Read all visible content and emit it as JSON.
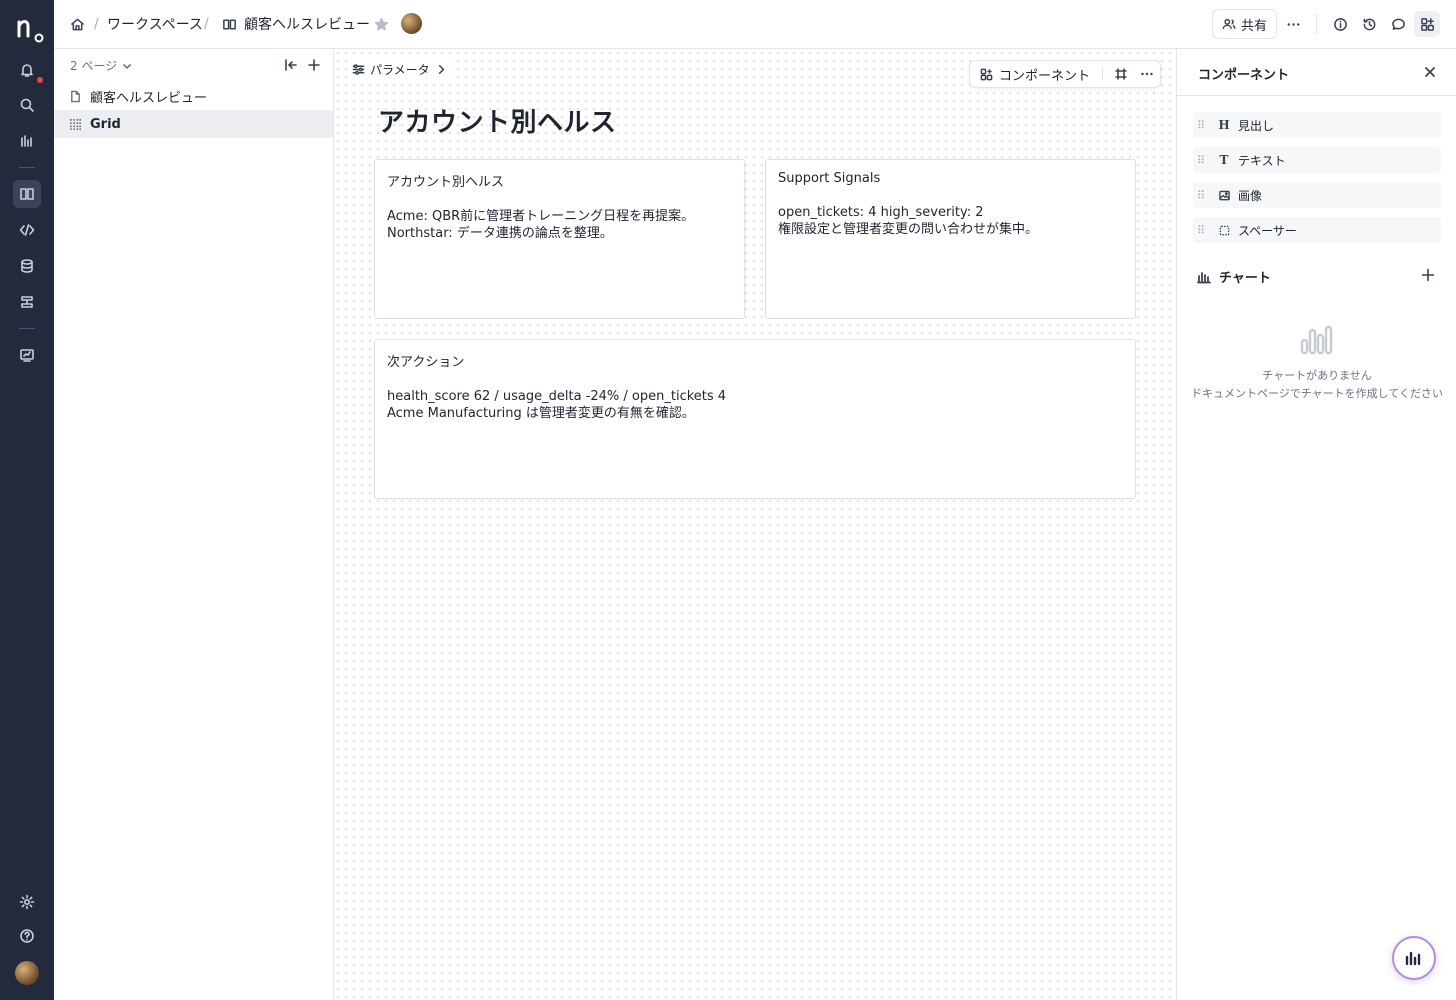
{
  "topbar": {
    "breadcrumb_workspace": "ワークスペース",
    "breadcrumb_doc": "顧客ヘルスレビュー",
    "share_label": "共有"
  },
  "pages": {
    "count_label": "2 ページ",
    "items": [
      {
        "label": "顧客ヘルスレビュー"
      },
      {
        "label": "Grid"
      }
    ]
  },
  "canvas": {
    "params_label": "パラメータ",
    "component_button": "コンポーネント",
    "title": "アカウント別ヘルス",
    "cards": [
      {
        "title": "アカウント別ヘルス",
        "line1": "Acme: QBR前に管理者トレーニング日程を再提案。",
        "line2": "Northstar: データ連携の論点を整理。"
      },
      {
        "title": "Support Signals",
        "line1": "open_tickets: 4 high_severity: 2",
        "line2": "権限設定と管理者変更の問い合わせが集中。"
      },
      {
        "title": "次アクション",
        "line1": "health_score 62 / usage_delta -24% / open_tickets 4",
        "line2": "Acme Manufacturing は管理者変更の有無を確認。"
      }
    ]
  },
  "components_panel": {
    "title": "コンポーネント",
    "items": [
      {
        "icon": "H",
        "label": "見出し"
      },
      {
        "icon": "T",
        "label": "テキスト"
      },
      {
        "icon": "image-icon",
        "label": "画像"
      },
      {
        "icon": "spacer-icon",
        "label": "スペーサー"
      }
    ],
    "chart_section": "チャート",
    "empty_line1": "チャートがありません",
    "empty_line2": "ドキュメントページでチャートを作成してください"
  },
  "colors": {
    "rail": "#232a3b",
    "notification_dot": "#e5484d",
    "fab_ring": "#b58ad8"
  }
}
